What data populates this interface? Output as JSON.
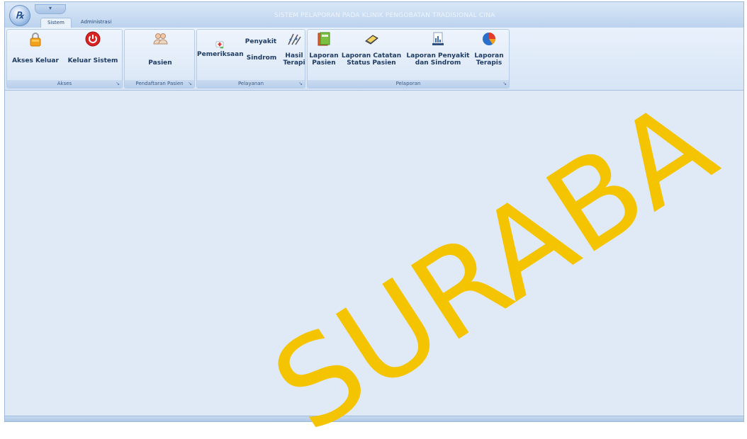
{
  "window": {
    "title": "SISTEM PELAPORAN PADA KLINIK PENGOBATAN TRADISIONAL CINA",
    "app_orb_glyph": "℞",
    "qat_glyph": "▾"
  },
  "tabs": [
    {
      "label": "Sistem",
      "active": true
    },
    {
      "label": "Administrasi",
      "active": false
    }
  ],
  "groups": {
    "akses": {
      "label": "Akses",
      "launcher": "↘"
    },
    "pendaftaran": {
      "label": "Pendaftaran Pasien",
      "launcher": "↘"
    },
    "pelayanan": {
      "label": "Pelayanan",
      "launcher": "↘"
    },
    "pelaporan": {
      "label": "Pelaporan",
      "launcher": "↘"
    }
  },
  "buttons": {
    "akses_keluar": {
      "label": "Akses Keluar",
      "icon": "lock-icon"
    },
    "keluar_sistem": {
      "label": "Keluar Sistem",
      "icon": "power-icon"
    },
    "pasien": {
      "label": "Pasien",
      "icon": "patients-icon"
    },
    "pemeriksaan": {
      "label": "Pemeriksaan",
      "icon": "medical-kit-icon"
    },
    "penyakit": {
      "label": "Penyakit"
    },
    "sindrom": {
      "label": "Sindrom"
    },
    "hasil_terapi": {
      "line1": "Hasil",
      "line2": "Terapi",
      "icon": "therapy-icon"
    },
    "laporan_pasien": {
      "line1": "Laporan",
      "line2": "Pasien",
      "icon": "report-book-icon"
    },
    "laporan_catatan": {
      "line1": "Laporan Catatan",
      "line2": "Status Pasien",
      "icon": "notes-icon"
    },
    "laporan_penyakit": {
      "line1": "Laporan Penyakit",
      "line2": "dan Sindrom",
      "icon": "document-chart-icon"
    },
    "laporan_terapis": {
      "line1": "Laporan",
      "line2": "Terapis",
      "icon": "pie-chart-icon"
    }
  },
  "watermark": {
    "text": "SURABA",
    "color": "#f5c400"
  },
  "colors": {
    "ribbon_text": "#1e3b63",
    "title_text": "#eef4fb",
    "background": "#dfeaf6"
  }
}
